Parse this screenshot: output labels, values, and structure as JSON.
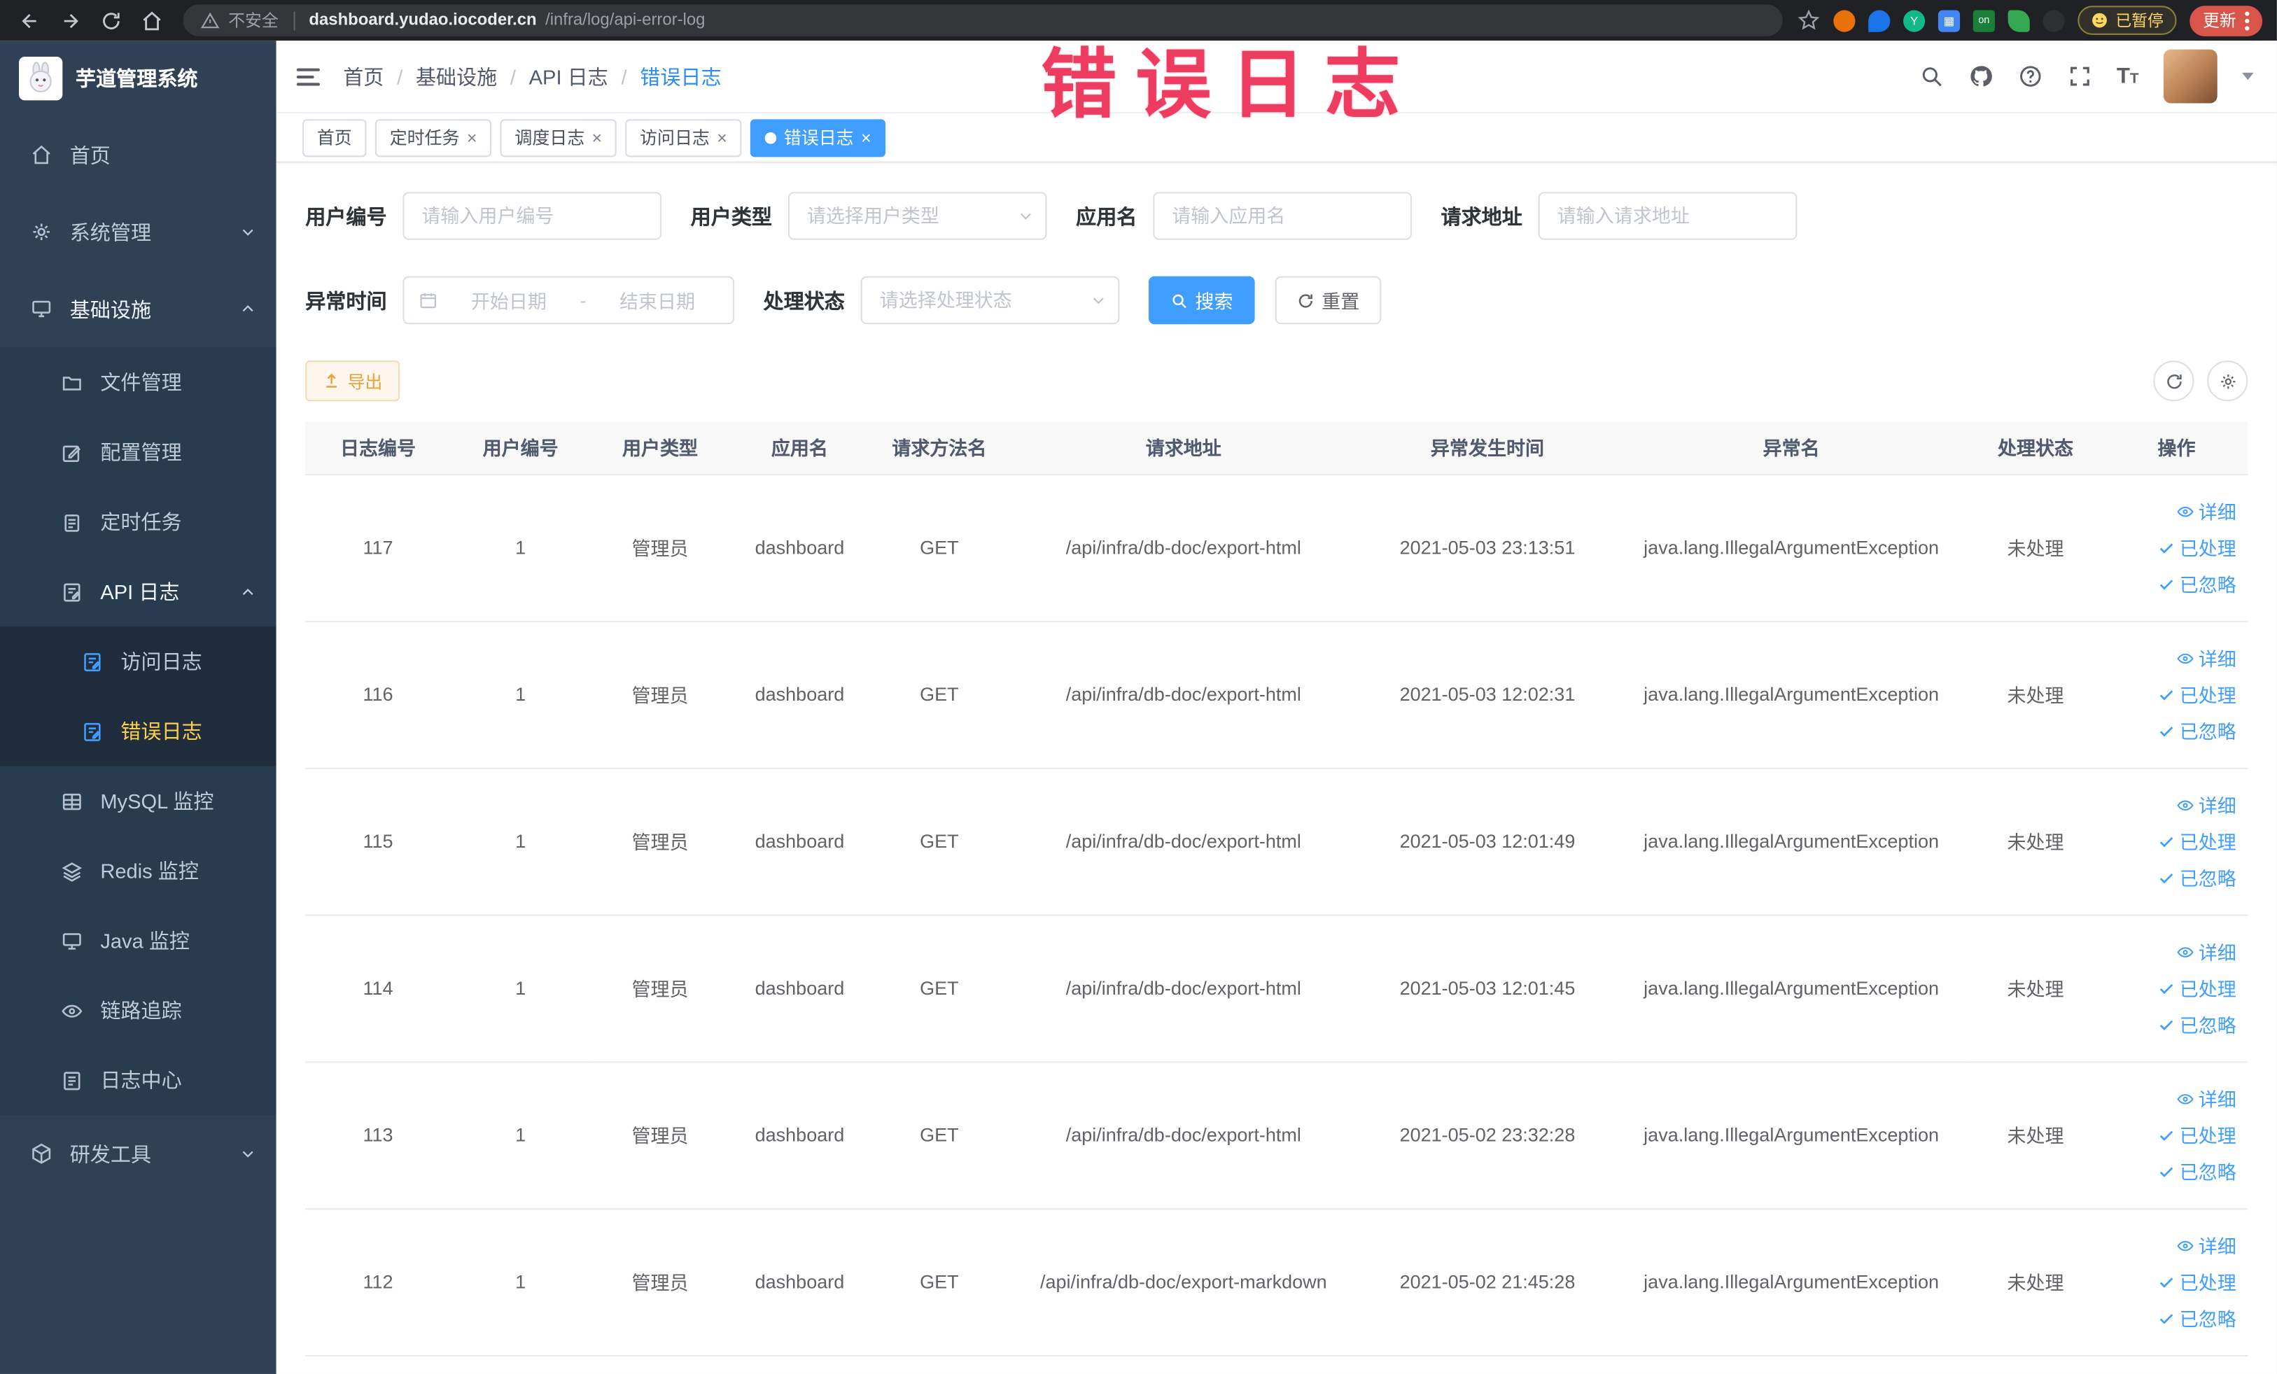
{
  "browser": {
    "security_label": "不安全",
    "url_host": "dashboard.yudao.iocoder.cn",
    "url_path": "/infra/log/api-error-log",
    "extension_on_label": "on",
    "paused_badge": "已暂停",
    "update_label": "更新"
  },
  "overlay_title": "错误日志",
  "sidebar": {
    "logo_title": "芋道管理系统",
    "items": {
      "home": "首页",
      "system": "系统管理",
      "infra": "基础设施",
      "file": "文件管理",
      "config": "配置管理",
      "job": "定时任务",
      "api_log": "API 日志",
      "access_log": "访问日志",
      "error_log": "错误日志",
      "mysql": "MySQL 监控",
      "redis": "Redis 监控",
      "java": "Java 监控",
      "trace": "链路追踪",
      "log_center": "日志中心",
      "dev_tools": "研发工具"
    }
  },
  "navbar": {
    "breadcrumb": [
      "首页",
      "基础设施",
      "API 日志",
      "错误日志"
    ]
  },
  "tabs": {
    "t0": "首页",
    "t1": "定时任务",
    "t2": "调度日志",
    "t3": "访问日志",
    "t4": "错误日志"
  },
  "filters": {
    "user_id_label": "用户编号",
    "user_id_placeholder": "请输入用户编号",
    "user_type_label": "用户类型",
    "user_type_placeholder": "请选择用户类型",
    "app_name_label": "应用名",
    "app_name_placeholder": "请输入应用名",
    "request_url_label": "请求地址",
    "request_url_placeholder": "请输入请求地址",
    "exception_time_label": "异常时间",
    "start_date_placeholder": "开始日期",
    "range_separator": "-",
    "end_date_placeholder": "结束日期",
    "process_status_label": "处理状态",
    "process_status_placeholder": "请选择处理状态",
    "search_button": "搜索",
    "reset_button": "重置"
  },
  "toolbar": {
    "export_button": "导出"
  },
  "table": {
    "columns": [
      "日志编号",
      "用户编号",
      "用户类型",
      "应用名",
      "请求方法名",
      "请求地址",
      "异常发生时间",
      "异常名",
      "处理状态",
      "操作"
    ],
    "actions": {
      "detail": "详细",
      "processed": "已处理",
      "ignored": "已忽略"
    },
    "rows": [
      {
        "id": "117",
        "user_id": "1",
        "user_type": "管理员",
        "app": "dashboard",
        "method": "GET",
        "url": "/api/infra/db-doc/export-html",
        "time": "2021-05-03 23:13:51",
        "exception": "java.lang.IllegalArgumentException",
        "status": "未处理"
      },
      {
        "id": "116",
        "user_id": "1",
        "user_type": "管理员",
        "app": "dashboard",
        "method": "GET",
        "url": "/api/infra/db-doc/export-html",
        "time": "2021-05-03 12:02:31",
        "exception": "java.lang.IllegalArgumentException",
        "status": "未处理"
      },
      {
        "id": "115",
        "user_id": "1",
        "user_type": "管理员",
        "app": "dashboard",
        "method": "GET",
        "url": "/api/infra/db-doc/export-html",
        "time": "2021-05-03 12:01:49",
        "exception": "java.lang.IllegalArgumentException",
        "status": "未处理"
      },
      {
        "id": "114",
        "user_id": "1",
        "user_type": "管理员",
        "app": "dashboard",
        "method": "GET",
        "url": "/api/infra/db-doc/export-html",
        "time": "2021-05-03 12:01:45",
        "exception": "java.lang.IllegalArgumentException",
        "status": "未处理"
      },
      {
        "id": "113",
        "user_id": "1",
        "user_type": "管理员",
        "app": "dashboard",
        "method": "GET",
        "url": "/api/infra/db-doc/export-html",
        "time": "2021-05-02 23:32:28",
        "exception": "java.lang.IllegalArgumentException",
        "status": "未处理"
      },
      {
        "id": "112",
        "user_id": "1",
        "user_type": "管理员",
        "app": "dashboard",
        "method": "GET",
        "url": "/api/infra/db-doc/export-markdown",
        "time": "2021-05-02 21:45:28",
        "exception": "java.lang.IllegalArgumentException",
        "status": "未处理"
      }
    ]
  }
}
